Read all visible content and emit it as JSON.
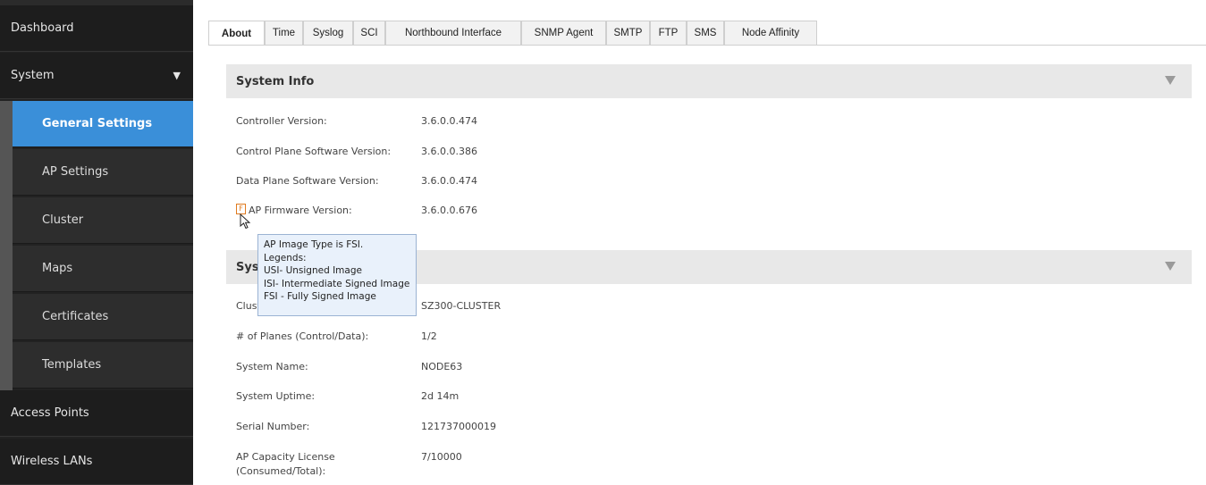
{
  "sidebar": {
    "items": [
      {
        "label": "Dashboard"
      },
      {
        "label": "System"
      },
      {
        "label": "Access Points"
      },
      {
        "label": "Wireless LANs"
      }
    ],
    "system_arrow": "▼",
    "system_children": [
      {
        "label": "General Settings",
        "active": true
      },
      {
        "label": "AP Settings"
      },
      {
        "label": "Cluster"
      },
      {
        "label": "Maps"
      },
      {
        "label": "Certificates"
      },
      {
        "label": "Templates"
      }
    ]
  },
  "tabs": [
    {
      "label": "About",
      "active": true
    },
    {
      "label": "Time"
    },
    {
      "label": "Syslog"
    },
    {
      "label": "SCI"
    },
    {
      "label": "Northbound Interface"
    },
    {
      "label": "SNMP Agent"
    },
    {
      "label": "SMTP"
    },
    {
      "label": "FTP"
    },
    {
      "label": "SMS"
    },
    {
      "label": "Node Affinity"
    }
  ],
  "system_info": {
    "title": "System Info",
    "rows": [
      {
        "label": "Controller Version:",
        "value": "3.6.0.0.474"
      },
      {
        "label": "Control Plane Software Version:",
        "value": "3.6.0.0.386"
      },
      {
        "label": "Data Plane Software Version:",
        "value": "3.6.0.0.474"
      },
      {
        "label": "AP Firmware Version:",
        "value": "3.6.0.0.676"
      }
    ],
    "info_icon_text": "F"
  },
  "second_section": {
    "title": "Syst",
    "rows": [
      {
        "label": "Clust",
        "value": "SZ300-CLUSTER"
      },
      {
        "label": "# of Planes (Control/Data):",
        "value": "1/2"
      },
      {
        "label": "System Name:",
        "value": "NODE63"
      },
      {
        "label": "System Uptime:",
        "value": "2d 14m"
      },
      {
        "label": "Serial Number:",
        "value": "121737000019"
      },
      {
        "label": "AP Capacity License",
        "label2": "(Consumed/Total):",
        "value": "7/10000"
      }
    ]
  },
  "tooltip": {
    "lines": [
      "AP Image Type is FSI.",
      "Legends:",
      "USI- Unsigned Image",
      "ISI- Intermediate Signed Image",
      "FSI - Fully Signed Image"
    ]
  }
}
